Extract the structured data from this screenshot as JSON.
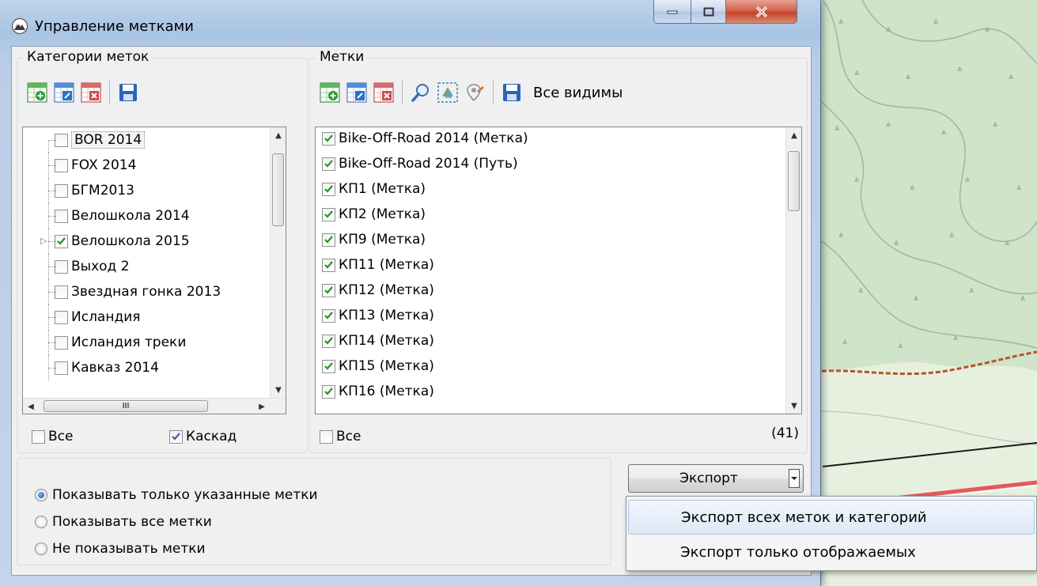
{
  "window": {
    "title": "Управление метками"
  },
  "categories": {
    "group_label": "Категории меток",
    "items": [
      {
        "label": "BOR 2014",
        "checked": false
      },
      {
        "label": "FOX 2014",
        "checked": false
      },
      {
        "label": "БГМ2013",
        "checked": false
      },
      {
        "label": "Велошкола 2014",
        "checked": false
      },
      {
        "label": "Велошкола 2015",
        "checked": true
      },
      {
        "label": "Выход 2",
        "checked": false
      },
      {
        "label": "Звездная гонка 2013",
        "checked": false
      },
      {
        "label": "Исландия",
        "checked": false
      },
      {
        "label": "Исландия треки",
        "checked": false
      },
      {
        "label": "Кавказ 2014",
        "checked": false
      }
    ],
    "hscroll_grip": "III",
    "all_label": "Все",
    "cascade_label": "Каскад"
  },
  "marks": {
    "group_label": "Метки",
    "all_visible_label": "Все видимы",
    "items": [
      {
        "label": "Bike-Off-Road 2014 (Метка)",
        "checked": true
      },
      {
        "label": "Bike-Off-Road 2014 (Путь)",
        "checked": true
      },
      {
        "label": "КП1 (Метка)",
        "checked": true
      },
      {
        "label": "КП2 (Метка)",
        "checked": true
      },
      {
        "label": "КП9 (Метка)",
        "checked": true
      },
      {
        "label": "КП11 (Метка)",
        "checked": true
      },
      {
        "label": "КП12 (Метка)",
        "checked": true
      },
      {
        "label": "КП13 (Метка)",
        "checked": true
      },
      {
        "label": "КП14 (Метка)",
        "checked": true
      },
      {
        "label": "КП15 (Метка)",
        "checked": true
      },
      {
        "label": "КП16 (Метка)",
        "checked": true
      }
    ],
    "all_label": "Все",
    "count": "(41)"
  },
  "display": {
    "options": [
      {
        "label": "Показывать только указанные метки",
        "selected": true
      },
      {
        "label": "Показывать все метки",
        "selected": false
      },
      {
        "label": "Не показывать метки",
        "selected": false
      }
    ]
  },
  "export": {
    "button_label": "Экспорт",
    "menu": [
      "Экспорт всех меток и категорий",
      "Экспорт только отображаемых"
    ]
  },
  "colors": {
    "add": "#2e9a2e",
    "edit": "#2f6fc4",
    "delete": "#d24a4a",
    "save": "#2a64b8",
    "check": "#1f9a1f"
  }
}
